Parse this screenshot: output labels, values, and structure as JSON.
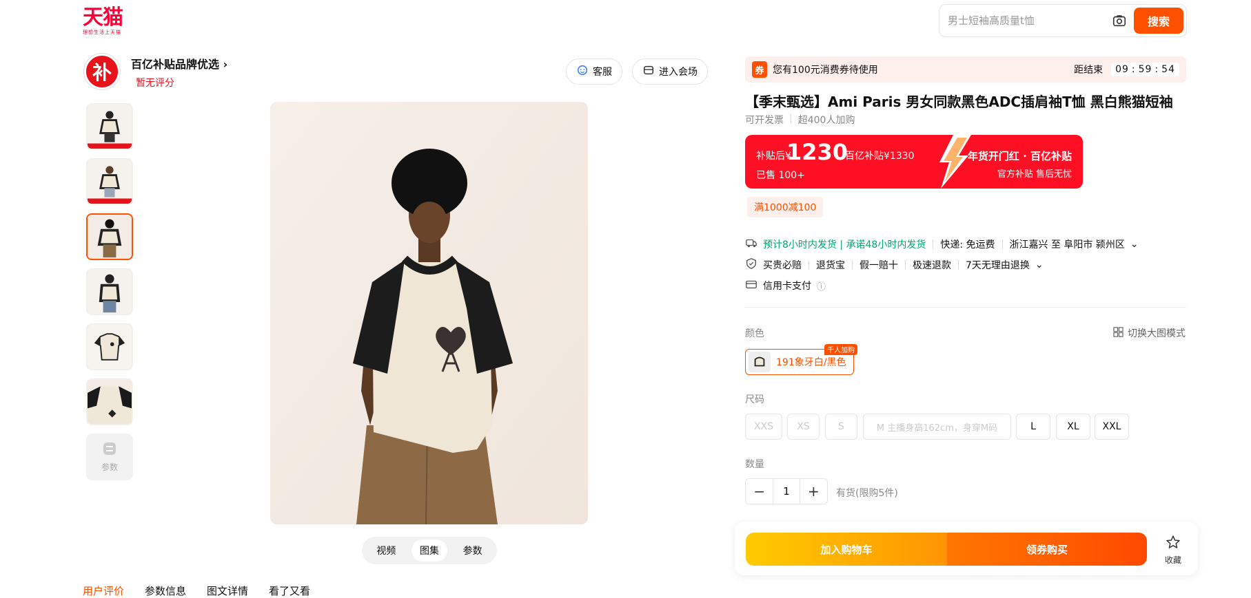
{
  "header": {
    "logo_text": "天猫",
    "logo_subtext": "理想生活上天猫",
    "search_placeholder": "男士短袖高质量t恤",
    "search_button": "搜索"
  },
  "shop": {
    "logo_text": "补",
    "name": "百亿补贴品牌优选",
    "rating": "暂无评分",
    "service_button": "客服",
    "venue_button": "进入会场"
  },
  "gallery": {
    "params_label": "参数",
    "media_tabs": [
      "视频",
      "图集",
      "参数"
    ],
    "active_tab": "图集"
  },
  "bottom_tabs": [
    "用户评价",
    "参数信息",
    "图文详情",
    "看了又看"
  ],
  "product": {
    "coupon_icon": "券",
    "coupon_text": "您有100元消费券待使用",
    "countdown_label": "距结束",
    "countdown": [
      "09",
      "59",
      "54"
    ],
    "title": "【季末甄选】Ami Paris 男女同款黑色ADC插肩袖T恤 黑白熊猫短袖",
    "invoice": "可开发票",
    "cart_count": "超400人加购",
    "price_label": "补贴后¥",
    "price": "1230",
    "original": "百亿补贴¥1330",
    "sold": "已售 100+",
    "promo_title": "年货开门红 · 百亿补贴",
    "promo_sub": "官方补贴 售后无忧",
    "discount": "满1000减100",
    "shipping_promise": "预计8小时内发货 | 承诺48小时内发货",
    "shipping_fee": "快递: 免运费",
    "route": "浙江嘉兴 至 阜阳市 颍州区",
    "guarantees": [
      "买贵必赔",
      "退货宝",
      "假一赔十",
      "极速退款",
      "7天无理由退换"
    ],
    "payment": "信用卡支付",
    "color_label": "颜色",
    "switch_mode": "切换大图模式",
    "color_option": "191象牙白/黑色",
    "color_badge": "千人加购",
    "size_label": "尺码",
    "sizes": [
      "XXS",
      "XS",
      "S",
      "M 主播身高162cm，身穿M码",
      "L",
      "XL",
      "XXL"
    ],
    "qty_label": "数量",
    "qty": "1",
    "stock": "有货(限购5件)",
    "add_to_cart": "加入购物车",
    "buy_now": "领券购买",
    "favorite": "收藏"
  },
  "colors": {
    "accent": "#ff5000",
    "tmall_red": "#ff0036",
    "price_red": "#ff0f23",
    "green": "#00a870"
  }
}
